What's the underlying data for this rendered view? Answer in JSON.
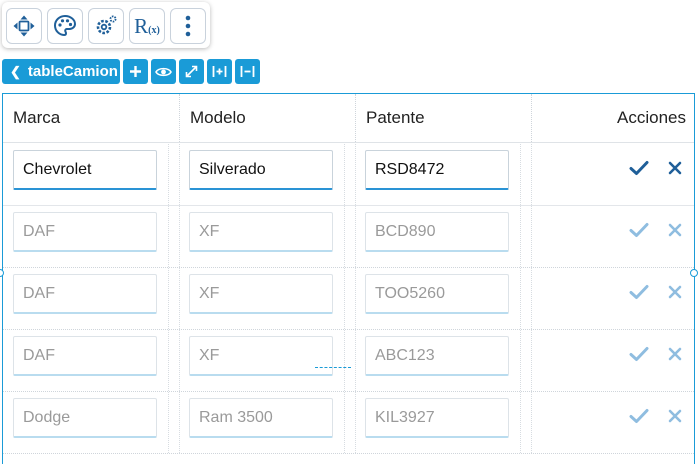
{
  "toolbar": {
    "buttons": [
      {
        "name": "move-icon"
      },
      {
        "name": "palette-icon"
      },
      {
        "name": "settings-icon"
      },
      {
        "name": "rx-icon",
        "label": "R",
        "sub": "(x)"
      },
      {
        "name": "more-vertical-icon"
      }
    ]
  },
  "component": {
    "name": "tableCamion",
    "controls": [
      "add-icon",
      "eye-icon",
      "expand-icon",
      "add-column-icon",
      "remove-column-icon"
    ]
  },
  "table": {
    "columns": [
      "Marca",
      "Modelo",
      "Patente",
      "Acciones"
    ],
    "rows": [
      {
        "marca": "Chevrolet",
        "modelo": "Silverado",
        "patente": "RSD8472",
        "active": true
      },
      {
        "marca": "DAF",
        "modelo": "XF",
        "patente": "BCD890",
        "active": false
      },
      {
        "marca": "DAF",
        "modelo": "XF",
        "patente": "TOO5260",
        "active": false
      },
      {
        "marca": "DAF",
        "modelo": "XF",
        "patente": "ABC123",
        "active": false
      },
      {
        "marca": "Dodge",
        "modelo": "Ram 3500",
        "patente": "KIL3927",
        "active": false
      }
    ]
  },
  "colors": {
    "accent": "#1a9bd7",
    "icon": "#1f5f99",
    "action_active": "#1f5f99",
    "action_inactive": "#8fbde0"
  }
}
